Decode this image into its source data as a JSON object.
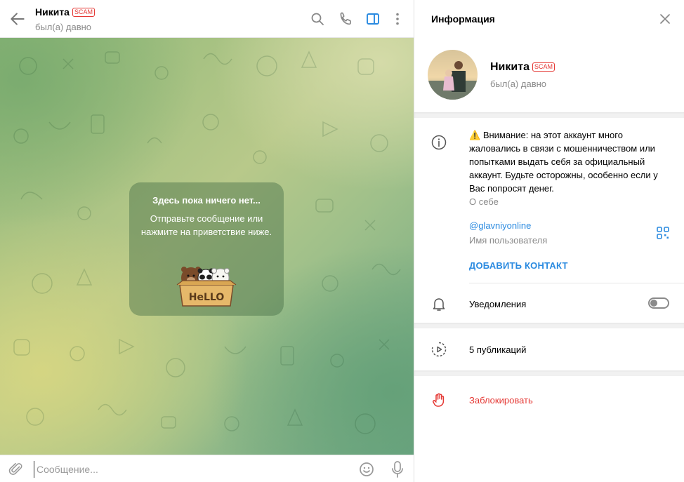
{
  "chat": {
    "peer_name": "Никита",
    "scam_badge": "SCAM",
    "peer_status": "был(а) давно",
    "empty_title": "Здесь пока ничего нет...",
    "empty_text": "Отправьте сообщение или нажмите на приветствие ниже.",
    "sticker_text": "HeLLO",
    "input_placeholder": "Сообщение..."
  },
  "header_icons": [
    "back-arrow-icon",
    "search-icon",
    "phone-icon",
    "sidebar-toggle-icon",
    "more-vertical-icon"
  ],
  "info": {
    "title": "Информация",
    "name": "Никита",
    "scam_badge": "SCAM",
    "status": "был(а) давно",
    "warning_icon": "⚠️",
    "about_text": "Внимание: на этот аккаунт много жаловались в связи с мошенничеством или попытками выдать себя за официальный аккаунт. Будьте осторожны, особенно если у Вас попросят денег.",
    "about_label": "О себе",
    "username": "@glavniyonline",
    "username_label": "Имя пользователя",
    "add_contact": "ДОБАВИТЬ КОНТАКТ",
    "notifications_label": "Уведомления",
    "notifications_on": false,
    "posts_label": "5 публикаций",
    "block_label": "Заблокировать"
  },
  "colors": {
    "accent": "#2a8ae0",
    "danger": "#e53935",
    "active_icon": "#2a8ae0"
  }
}
